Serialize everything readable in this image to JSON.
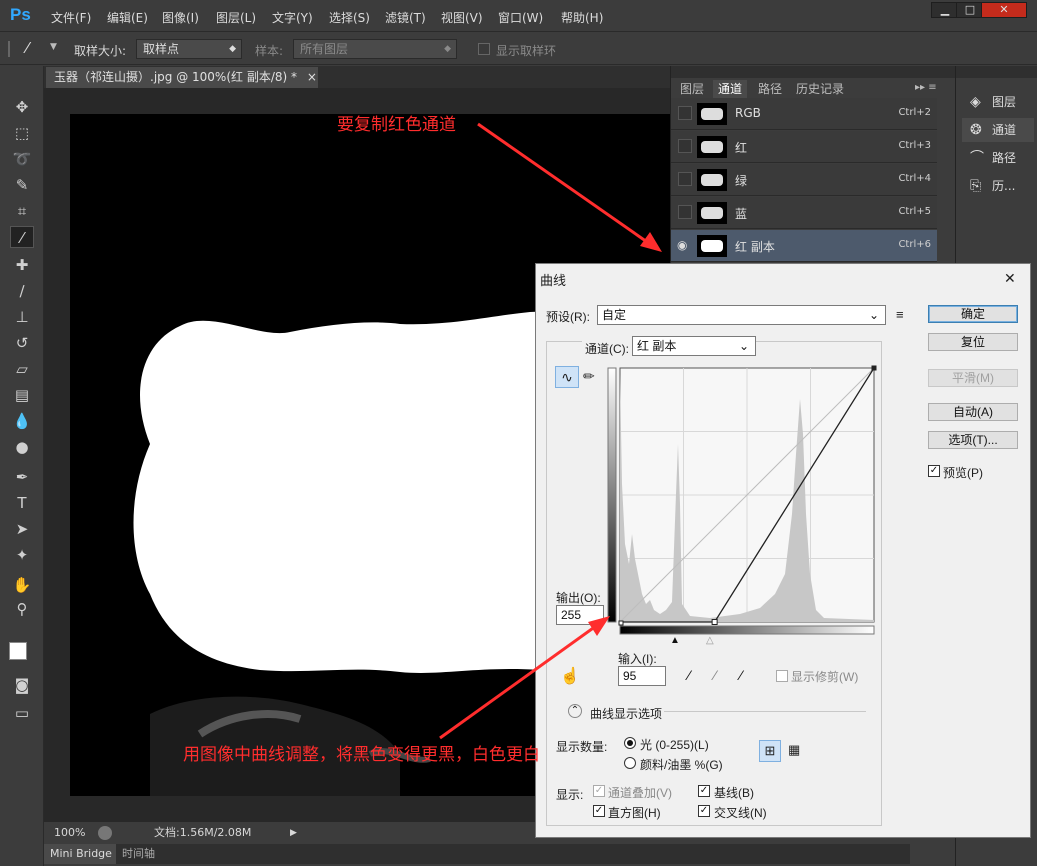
{
  "app": {
    "logo": "Ps"
  },
  "menu": [
    "文件(F)",
    "编辑(E)",
    "图像(I)",
    "图层(L)",
    "文字(Y)",
    "选择(S)",
    "滤镜(T)",
    "视图(V)",
    "窗口(W)",
    "帮助(H)"
  ],
  "window_controls": {
    "minimize": "▁",
    "restore": "□",
    "close": "✕"
  },
  "options": {
    "sample_size_label": "取样大小:",
    "sample_size_value": "取样点",
    "sample_label": "样本:",
    "sample_value": "所有图层",
    "show_ring": "显示取样环"
  },
  "document": {
    "tab_title": "玉器（祁连山摄）.jpg @ 100%(红 副本/8) *",
    "close": "×"
  },
  "status": {
    "zoom": "100%",
    "doc_info": "文档:1.56M/2.08M"
  },
  "bottom_tabs": [
    "Mini Bridge",
    "时间轴"
  ],
  "panel": {
    "tabs": [
      "图层",
      "通道",
      "路径",
      "历史记录"
    ],
    "channels": [
      {
        "name": "RGB",
        "shortcut": "Ctrl+2"
      },
      {
        "name": "红",
        "shortcut": "Ctrl+3"
      },
      {
        "name": "绿",
        "shortcut": "Ctrl+4"
      },
      {
        "name": "蓝",
        "shortcut": "Ctrl+5"
      },
      {
        "name": "红 副本",
        "shortcut": "Ctrl+6"
      }
    ]
  },
  "mini_panel": [
    "图层",
    "通道",
    "路径",
    "历..."
  ],
  "curves": {
    "title": "曲线",
    "close": "✕",
    "preset_label": "预设(R):",
    "preset_value": "自定",
    "channel_label": "通道(C):",
    "channel_value": "红 副本",
    "output_label": "输出(O):",
    "output_value": "255",
    "input_label": "输入(I):",
    "input_value": "95",
    "show_clipping": "显示修剪(W)",
    "display_options": "曲线显示选项",
    "show_amount_label": "显示数量:",
    "light_option": "光 (0-255)(L)",
    "pigment_option": "颜料/油墨 %(G)",
    "show_label": "显示:",
    "channel_overlay": "通道叠加(V)",
    "baseline": "基线(B)",
    "histogram": "直方图(H)",
    "intersection": "交叉线(N)",
    "buttons": {
      "ok": "确定",
      "reset": "复位",
      "smooth": "平滑(M)",
      "auto": "自动(A)",
      "options": "选项(T)..."
    },
    "preview": "预览(P)",
    "curve_points": [
      [
        95,
        0
      ],
      [
        255,
        255
      ]
    ]
  },
  "annotations": {
    "top": "要复制红色通道",
    "bottom": "用图像中曲线调整，将黑色变得更黑，白色更白"
  },
  "colors": {
    "annotation": "#ff2d2d",
    "ps_blue": "#31a8ff",
    "selected_row": "#4d5a6c"
  }
}
